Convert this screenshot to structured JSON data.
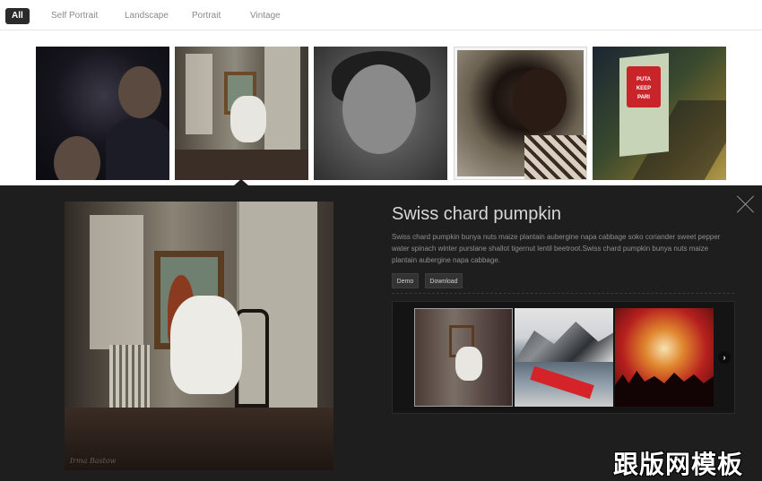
{
  "filters": [
    {
      "label": "All",
      "active": true
    },
    {
      "label": "Self Portrait",
      "active": false
    },
    {
      "label": "Landscape",
      "active": false
    },
    {
      "label": "Portrait",
      "active": false
    },
    {
      "label": "Vintage",
      "active": false
    }
  ],
  "thumbnails": [
    {
      "name": "boys-portrait-thumb"
    },
    {
      "name": "girl-in-room-thumb"
    },
    {
      "name": "child-face-thumb"
    },
    {
      "name": "smiling-boy-thumb"
    },
    {
      "name": "street-sign-thumb",
      "sign_text": "PUTA KEEP PARI"
    }
  ],
  "preview": {
    "title": "Swiss chard pumpkin",
    "description": "Swiss chard pumpkin bunya nuts maize plantain aubergine napa cabbage soko coriander sweet pepper water spinach winter purslane shallot tigernut lentil beetroot.Swiss chard pumpkin bunya nuts maize plantain aubergine napa cabbage.",
    "demo_label": "Demo",
    "download_label": "Download",
    "image_signature": "Irma Bastow",
    "next_icon": "chevron-right-icon",
    "close_icon": "close-x-icon"
  },
  "watermark": "跟版网模板"
}
